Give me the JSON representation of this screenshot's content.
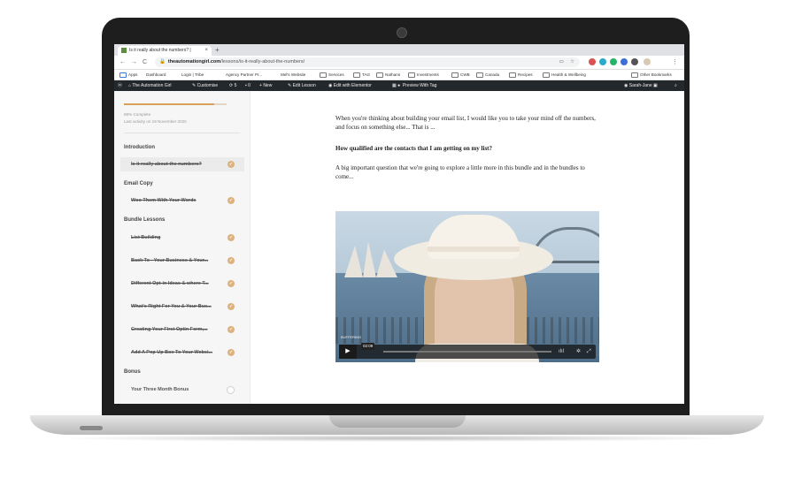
{
  "browser": {
    "tab_title": "Is it really about the numbers? |",
    "tab_close": "×",
    "new_tab": "+",
    "nav": {
      "back": "←",
      "forward": "→",
      "reload": "C"
    },
    "url_domain": "theautomationgirl.com",
    "url_path": "/lessons/is-it-really-about-the-numbers/",
    "bookmarks": [
      "Apps",
      "Dashboard",
      "Login | Tribe",
      "Agency Partner Pr...",
      "Mel's Website",
      "Services",
      "TAG",
      "Nathans",
      "Investments",
      "CWB",
      "Canada",
      "Recipes",
      "Health & Wellbeing"
    ],
    "other_bookmarks": "Other Bookmarks"
  },
  "wp_admin_bar": {
    "site_name": "The Automation Girl",
    "customise": "Customise",
    "updates_count": "5",
    "comments_count": "0",
    "new": "New",
    "edit_lesson": "Edit Lesson",
    "edit_elementor": "Edit with Elementor",
    "preview_tag": "Preview With Tag",
    "user": "Sarah-Jane"
  },
  "sidebar": {
    "progress_percent": 88,
    "complete_text": "88% Complete",
    "last_activity": "Last activity on 19 November 2020",
    "sections": [
      {
        "title": "Introduction",
        "lessons": [
          {
            "title": "Is it really about the numbers?",
            "done": true,
            "active": true
          }
        ]
      },
      {
        "title": "Email Copy",
        "lessons": [
          {
            "title": "Woo Them With Your Words",
            "done": true
          }
        ]
      },
      {
        "title": "Bundle Lessons",
        "lessons": [
          {
            "title": "List Building",
            "done": true
          },
          {
            "title": "Back To - Your Business & Your...",
            "done": true
          },
          {
            "title": "Different Opt-in Ideas & where T...",
            "done": true
          },
          {
            "title": "What's Right For You & Your Bus...",
            "done": true
          },
          {
            "title": "Creating Your First Optin Form,...",
            "done": true
          },
          {
            "title": "Add A Pop Up Box To Your Websi...",
            "done": true
          }
        ]
      },
      {
        "title": "Bonus",
        "lessons": [
          {
            "title": "Your Three Month Bonus",
            "done": false
          }
        ]
      }
    ]
  },
  "content": {
    "para1": "When you're thinking about building your email list, I would like you to take your mind off the numbers, and focus on something else... That is ...",
    "para2": "How qualified are the contacts that I am getting on my list?",
    "para3": "A big important question that we're going to explore a little more in this bundle and in the bundles to come..."
  },
  "video": {
    "time": "02:09",
    "status": "BUFFERING"
  }
}
